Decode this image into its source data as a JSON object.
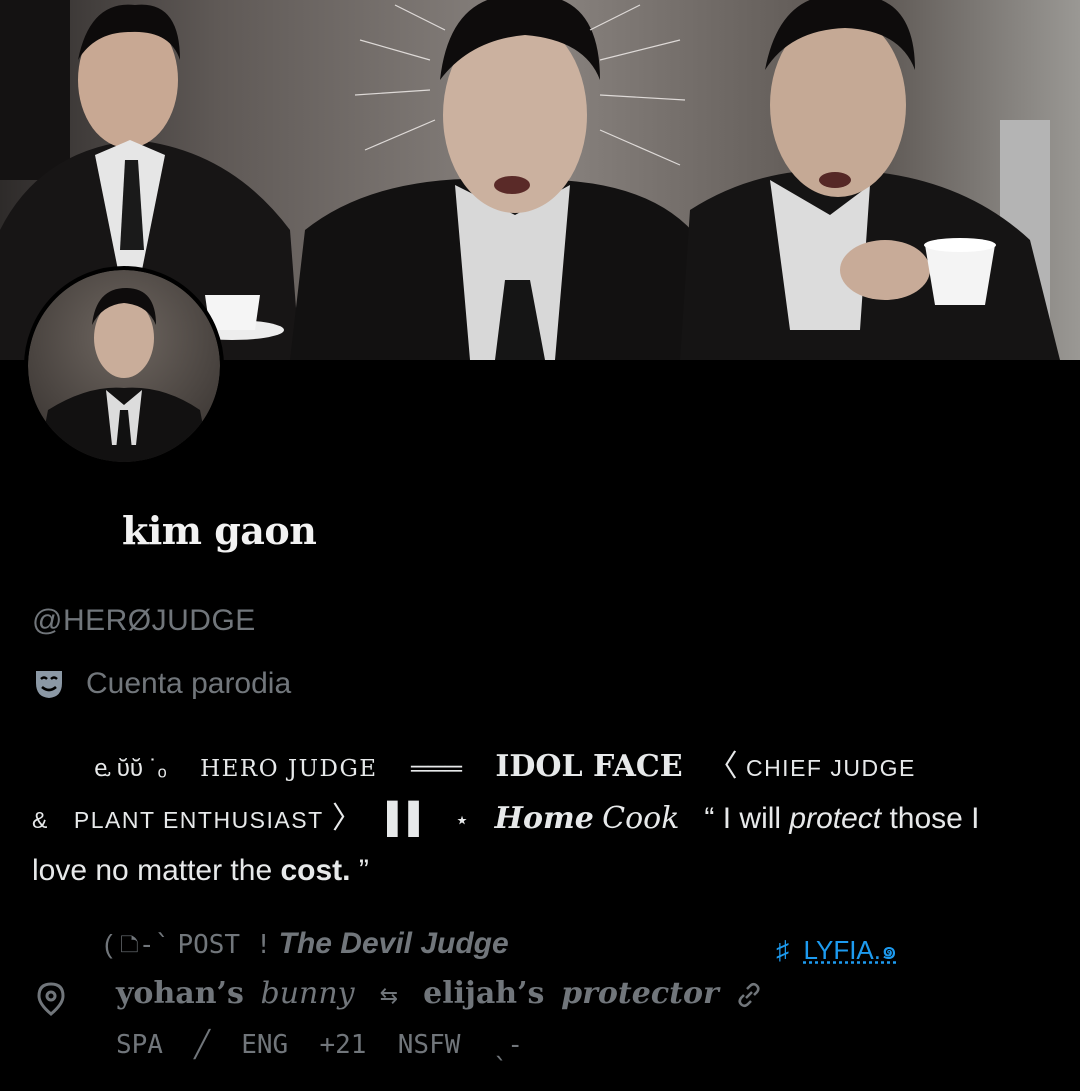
{
  "profile": {
    "display_name": "kim gaon",
    "handle": "@HERØJUDGE",
    "parody_label": "Cuenta parodia"
  },
  "bio": {
    "line1_prefix": "ⱸ ῠῠ ˙ₒ",
    "hero_judge": "HERO JUDGE",
    "bar_glyph": "═══",
    "idol_face": "IDOL FACE",
    "bracket_open": "〈",
    "chief_judge": "CHIEF JUDGE",
    "amp": "&",
    "plant": "PLANT ENTHUSIAST",
    "bracket_close": "〉",
    "pause_glyph": "▌▌",
    "star": "⋆",
    "home": "Home",
    "cook": "Cook",
    "quote_a": "“ I will ",
    "protect": "protect",
    "quote_b": " those I love no matter the ",
    "cost": "cost.",
    "quote_end": " ”"
  },
  "meta": {
    "paren": "(",
    "post_icon": "🗅-`",
    "post": "POST !",
    "devil_judge": "The Devil Judge",
    "hash": "♯",
    "lyfia": "LYFIA.๑",
    "yohans": "yohan’s",
    "bunny": "bunny",
    "arrows": "⇆",
    "elijahs": "elijah’s",
    "protector": "protector",
    "langs": "SPA  ╱  ENG  +21  NSFW  ˎ-"
  },
  "icons": {
    "parody": "theater-mask-icon",
    "location": "location-pin-icon",
    "website": "link-icon"
  },
  "colors": {
    "background": "#000000",
    "muted_text": "#71767b",
    "link": "#1d9bf0"
  }
}
